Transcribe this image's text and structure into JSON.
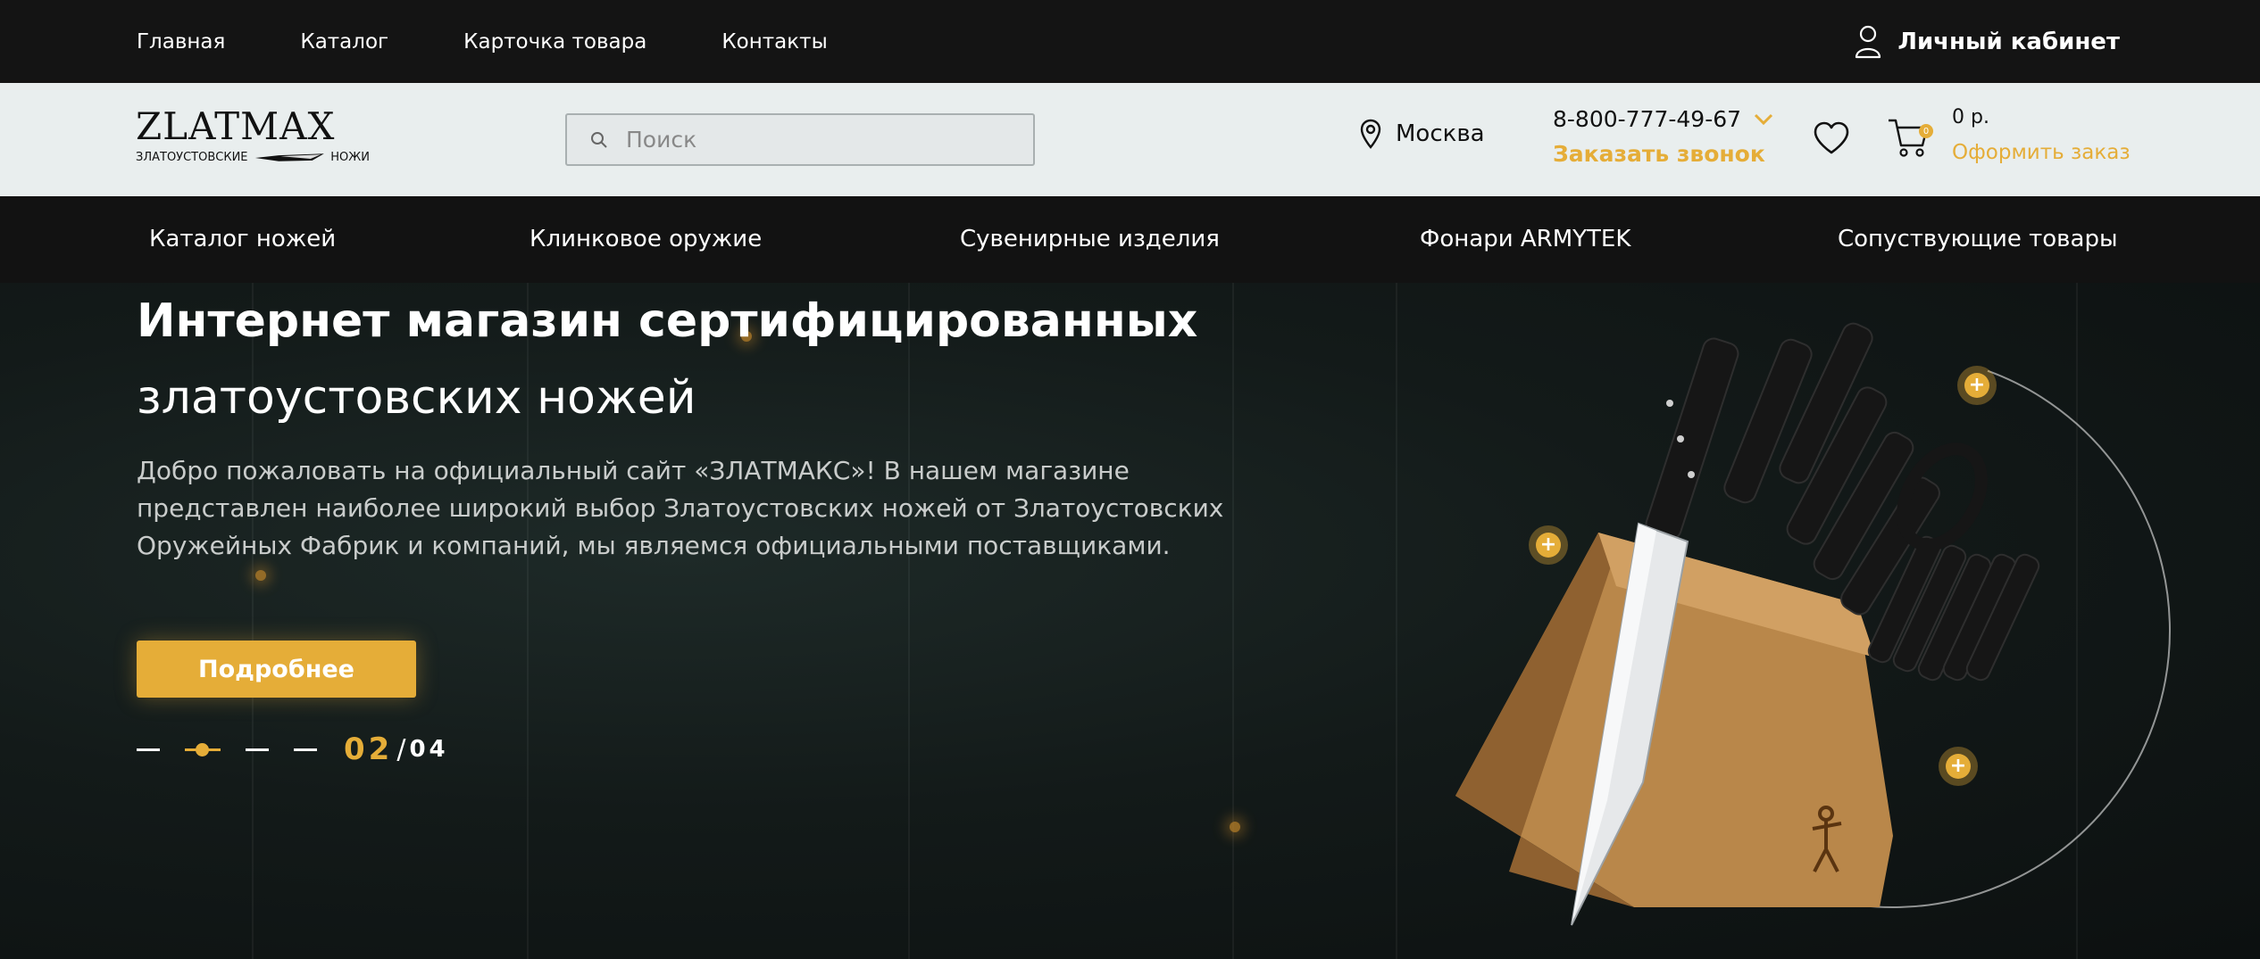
{
  "topbar": {
    "nav": [
      "Главная",
      "Каталог",
      "Карточка товара",
      "Контакты"
    ],
    "account_label": "Личный кабинет"
  },
  "header": {
    "logo": {
      "main": "ZLATMAX",
      "left": "ЗЛАТОУСТОВСКИЕ",
      "right": "НОЖИ"
    },
    "search": {
      "placeholder": "Поиск"
    },
    "city": "Москва",
    "phone": "8-800-777-49-67",
    "callback": "Заказать звонок",
    "cart": {
      "badge": "0",
      "sum": "0 р.",
      "order": "Оформить заказ"
    }
  },
  "catnav": [
    "Каталог ножей",
    "Клинковое оружие",
    "Сувенирные изделия",
    "Фонари ARMYTEK",
    "Сопуствующие товары"
  ],
  "hero": {
    "title_bold": "Интернет магазин сертифицированных",
    "title_regular": "златоустовских ножей",
    "text": "Добро пожаловать на официальный сайт «ЗЛАТМАКС»! В нашем магазине представлен наиболее широкий выбор Златоустовских ножей от Златоустовских Оружейных Фабрик и компаний, мы являемся официальными поставщиками.",
    "button": "Подробнее",
    "pager": {
      "current": "02",
      "separator": "/",
      "total": "04"
    },
    "hotspot_symbol": "+"
  },
  "colors": {
    "accent": "#e5ad38",
    "dark": "#141414",
    "header_bg": "#e9eeee"
  }
}
